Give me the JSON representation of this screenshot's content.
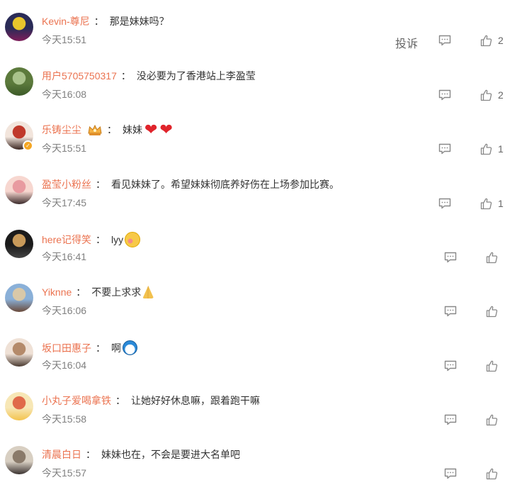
{
  "labels": {
    "report": "投诉"
  },
  "colors": {
    "username": "#eb7350",
    "text": "#333333",
    "time": "#808080",
    "icon": "#888888"
  },
  "comments": [
    {
      "username": "Kevin-尊尼",
      "colon": "：",
      "text": "那是妹妹吗？",
      "time": "今天15:51",
      "likes": "2",
      "avatar_colors": [
        "#2a2b57",
        "#e7c52c",
        "#7e1d5a"
      ]
    },
    {
      "username": "用户5705750317",
      "colon": "：",
      "text": "没必要为了香港站上李盈莹",
      "time": "今天16:08",
      "likes": "2",
      "avatar_colors": [
        "#5c7a3c",
        "#a9c28b",
        "#3c5a28"
      ]
    },
    {
      "username": "乐铸尘尘",
      "colon": "：",
      "text": "妹妹",
      "time": "今天15:51",
      "likes": "1",
      "avatar_colors": [
        "#f2e5dc",
        "#c0392b",
        "#3a2520"
      ],
      "emojis": [
        "heart",
        "heart"
      ],
      "badge": "crown",
      "verified": true
    },
    {
      "username": "盈莹小粉丝",
      "colon": "：",
      "text": "看见妹妹了。希望妹妹彻底养好伤在上场参加比赛。",
      "time": "今天17:45",
      "likes": "1",
      "avatar_colors": [
        "#f7d7d0",
        "#e89aa0",
        "#3a2a2a"
      ]
    },
    {
      "username": "here记得笑",
      "colon": "：",
      "text": "lyy",
      "time": "今天16:41",
      "likes": "",
      "avatar_colors": [
        "#1b1b1b",
        "#c89a5a",
        "#444"
      ],
      "emojis": [
        "blush"
      ]
    },
    {
      "username": "Yiknne",
      "colon": "：",
      "text": "不要上求求",
      "time": "今天16:06",
      "likes": "",
      "avatar_colors": [
        "#8ab0d8",
        "#d9c8a8",
        "#6a4a3a"
      ],
      "emojis": [
        "pray"
      ]
    },
    {
      "username": "坂口田惠子",
      "colon": "：",
      "text": "啊",
      "time": "今天16:04",
      "likes": "",
      "avatar_colors": [
        "#efe1d6",
        "#b48a6a",
        "#4a3a30"
      ],
      "emojis": [
        "doraemon"
      ]
    },
    {
      "username": "小丸子爱喝拿铁",
      "colon": "：",
      "text": "让她好好休息嘛，跟着跑干嘛",
      "time": "今天15:58",
      "likes": "",
      "avatar_colors": [
        "#f7e7b6",
        "#e06a4a",
        "#f3c34d"
      ]
    },
    {
      "username": "清晨白日",
      "colon": "：",
      "text": "妹妹也在，不会是要进大名单吧",
      "time": "今天15:57",
      "likes": "",
      "avatar_colors": [
        "#d8cfc2",
        "#8a7a6a",
        "#3a3230"
      ]
    }
  ]
}
